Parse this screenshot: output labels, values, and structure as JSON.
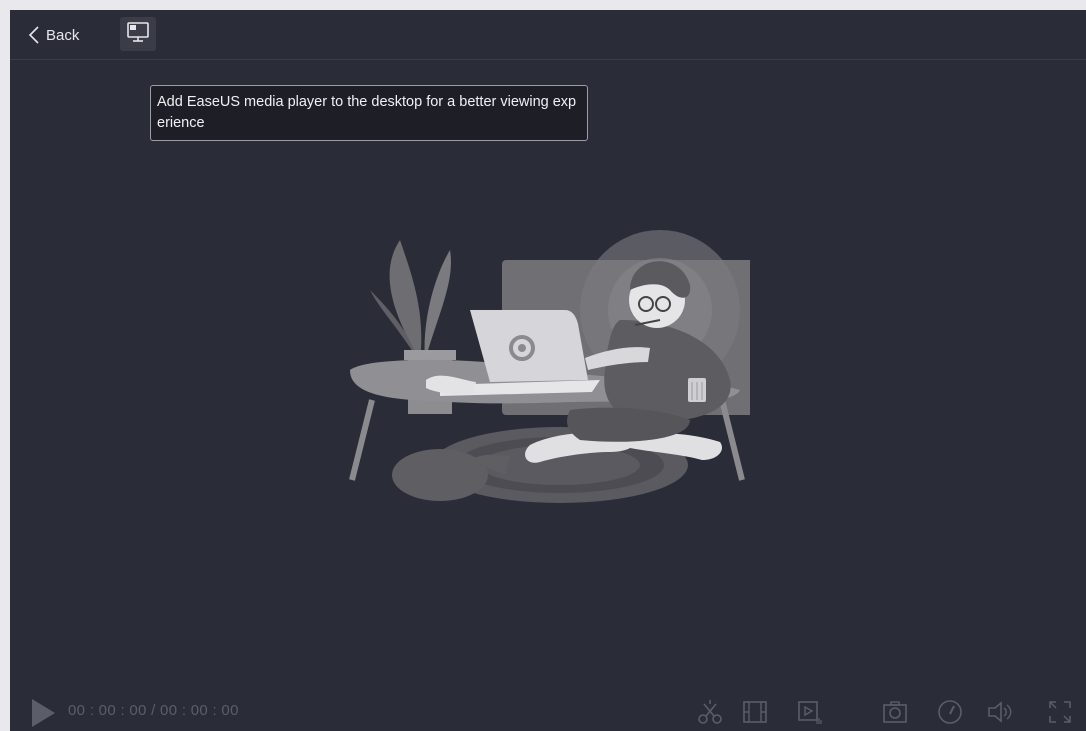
{
  "header": {
    "back_label": "Back"
  },
  "tooltip": {
    "text": "Add EaseUS media player to the desktop for a better viewing experience"
  },
  "player": {
    "time_display": "00 : 00 : 00 / 00 : 00 : 00"
  },
  "icons": {
    "back": "chevron-left-icon",
    "desktop": "desktop-monitor-icon",
    "play": "play-icon",
    "trim": "scissors-icon",
    "frame": "film-frame-icon",
    "subtitle": "video-audio-icon",
    "snapshot": "camera-icon",
    "speed": "speed-gauge-icon",
    "volume": "volume-icon",
    "fullscreen": "fullscreen-icon"
  },
  "colors": {
    "background": "#2a2c37",
    "text": "#e6e7ec",
    "muted_control": "#5b5d68"
  }
}
